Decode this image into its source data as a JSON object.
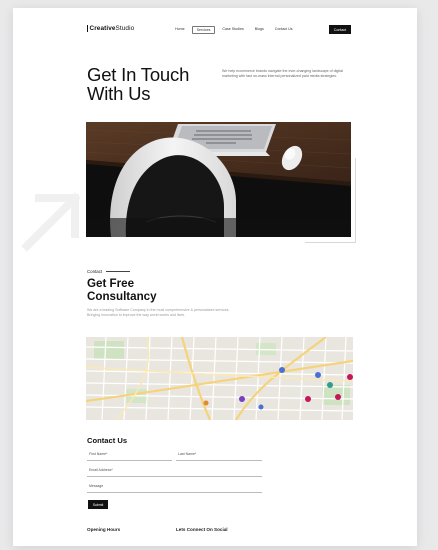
{
  "header": {
    "logo_bold": "Creative",
    "logo_light": "Studio",
    "nav": [
      {
        "label": "Home",
        "active": false
      },
      {
        "label": "Services",
        "active": true
      },
      {
        "label": "Case Studies",
        "active": false
      },
      {
        "label": "Blogs",
        "active": false
      },
      {
        "label": "Contact Us",
        "active": false
      }
    ],
    "contact_button": "Contact"
  },
  "hero": {
    "title_line1": "Get In Touch",
    "title_line2": "With Us",
    "description": "We help ecommerce brands navigate the ever-changing landscape of digital marketing with fast on-mass internal personalized paid media strategies."
  },
  "contact_section": {
    "kicker": "Contact",
    "title_line1": "Get Free",
    "title_line2": "Consultancy",
    "description": "We are a leading Software Company in the most comprehensive & personalized services. Bringing Innovation to improve the way world works and lives."
  },
  "form": {
    "title": "Contact Us",
    "first_name_placeholder": "First Name*",
    "last_name_placeholder": "Last Name*",
    "email_placeholder": "Email Address*",
    "message_placeholder": "Message",
    "submit_label": "Submit"
  },
  "footer_preview": {
    "left_heading": "Opening Hours",
    "right_heading": "Lets Connect On Social"
  },
  "colors": {
    "accent": "#111111",
    "page_background": "#ffffff",
    "outer_background": "#e9e9ea"
  }
}
